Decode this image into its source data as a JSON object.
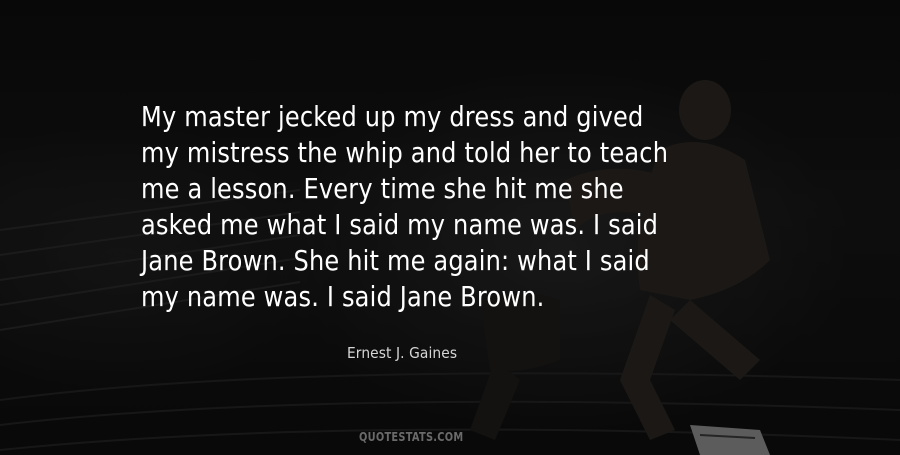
{
  "quote": {
    "lines": [
      "My master jecked up my dress and gived",
      "my mistress the whip and told her to teach",
      "me a lesson. Every time she hit me she",
      "asked me what I said my name was. I said",
      "Jane Brown. She hit me again: what I said",
      "my name was. I said Jane Brown."
    ]
  },
  "author": "Ernest J. Gaines",
  "watermark": "QUOTESTATS.COM",
  "colors": {
    "background": "#0b0b0b",
    "quote_text": "#ffffff",
    "author_text": "#d6d6d6",
    "watermark_text": "#6a6a6a"
  }
}
